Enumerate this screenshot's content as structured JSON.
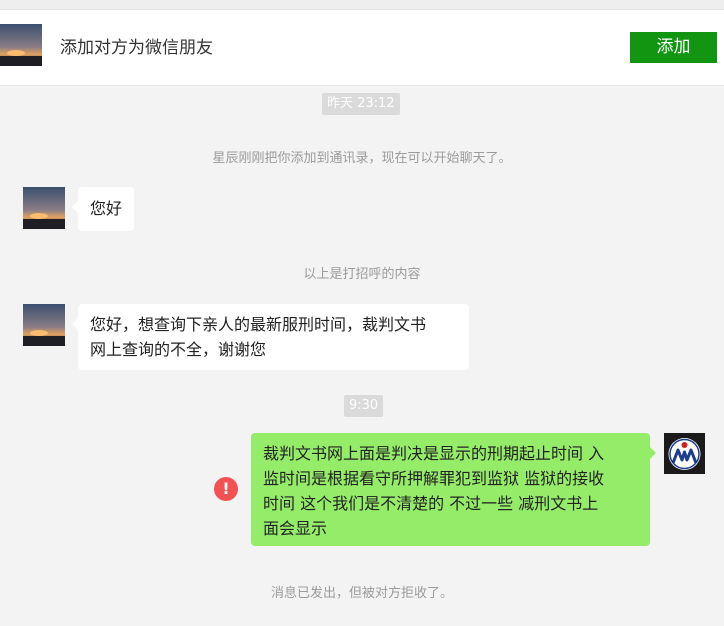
{
  "add_bar": {
    "prompt": "添加对方为微信朋友",
    "button_label": "添加"
  },
  "chat": {
    "time_1": "昨天 23:12",
    "system_added": "星辰刚刚把你添加到通讯录，现在可以开始聊天了。",
    "greeting": "您好",
    "system_greeting_divider": "以上是打招呼的内容",
    "message_1_line1": "您好，想查询下亲人的最新服刑时间，裁判文书",
    "message_1_line2": "网上查询的不全，谢谢您",
    "time_2": "9:30",
    "reply_line1": "裁判文书网上面是判决是显示的刑期起止时间 入",
    "reply_line2": "监时间是根据看守所押解罪犯到监狱 监狱的接收",
    "reply_line3": "时间 这个我们是不清楚的 不过一些 减刑文书上",
    "reply_line4": "面会显示",
    "error_mark": "!",
    "system_rejected": "消息已发出，但被对方拒收了。"
  },
  "colors": {
    "add_button": "#129611",
    "outgoing_bubble": "#95ec69",
    "incoming_bubble": "#ffffff",
    "error": "#f25252",
    "background": "#f3f3f3"
  },
  "icons": {
    "contact_avatar": "sunset-avatar-icon",
    "self_avatar": "logo-avatar-icon",
    "error": "exclamation-circle-icon"
  }
}
